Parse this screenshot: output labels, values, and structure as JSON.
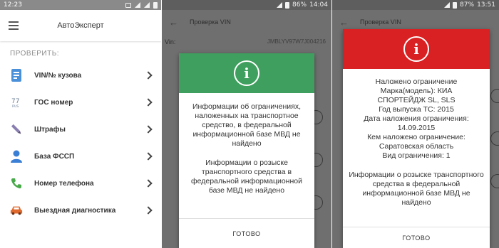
{
  "screen1": {
    "status_time": "12:23",
    "app_title": "АвтоЭксперт",
    "section_label": "ПРОВЕРИТЬ:",
    "items": [
      {
        "label": "VIN/№ кузова",
        "icon": "vin-card-icon",
        "color": "#4a90d9"
      },
      {
        "label": "ГОС номер",
        "icon": "license-plate-icon",
        "color": "#7a8ea8"
      },
      {
        "label": "Штрафы",
        "icon": "pen-icon",
        "color": "#8a7fb0"
      },
      {
        "label": "База ФССП",
        "icon": "person-icon",
        "color": "#3a7fd5"
      },
      {
        "label": "Номер телефона",
        "icon": "phone-icon",
        "color": "#49a84a"
      },
      {
        "label": "Выездная диагностика",
        "icon": "car-icon",
        "color": "#e06a2e"
      }
    ],
    "plate_icon_text": "77",
    "plate_icon_subtext": "RUS"
  },
  "screen2": {
    "status_battery": "86%",
    "status_time": "14:04",
    "toolbar_title": "Проверка VIN",
    "vin_label": "Vin:",
    "vin_value": "JMBLYV97W7J004216",
    "dialog_color": "#3f9f5f",
    "dialog_par1": "Информации об ограничениях, наложенных на транспортное средство, в федеральной информационной базе МВД не найдено",
    "dialog_par2": "Информации о розыске транспортного средства в федеральной информационной базе МВД не найдено",
    "button": "ГОТОВО"
  },
  "screen3": {
    "status_battery": "87%",
    "status_time": "13:51",
    "toolbar_title": "Проверка VIN",
    "dialog_color": "#d92022",
    "lines": [
      "Наложено ограничение",
      "Марка(модель): КИА",
      "СПОРТЕЙДЖ SL, SLS",
      "Год выпуска ТС: 2015",
      "Дата наложения ограничения:",
      "14.09.2015",
      "Кем наложено ограничение:",
      "Саратовская область",
      "Вид ограничения: 1"
    ],
    "dialog_par2": "Информации о розыске транспортного средства в федеральной информационной базе МВД не найдено",
    "button": "ГОТОВО"
  },
  "dialog_icon_glyph": "i"
}
